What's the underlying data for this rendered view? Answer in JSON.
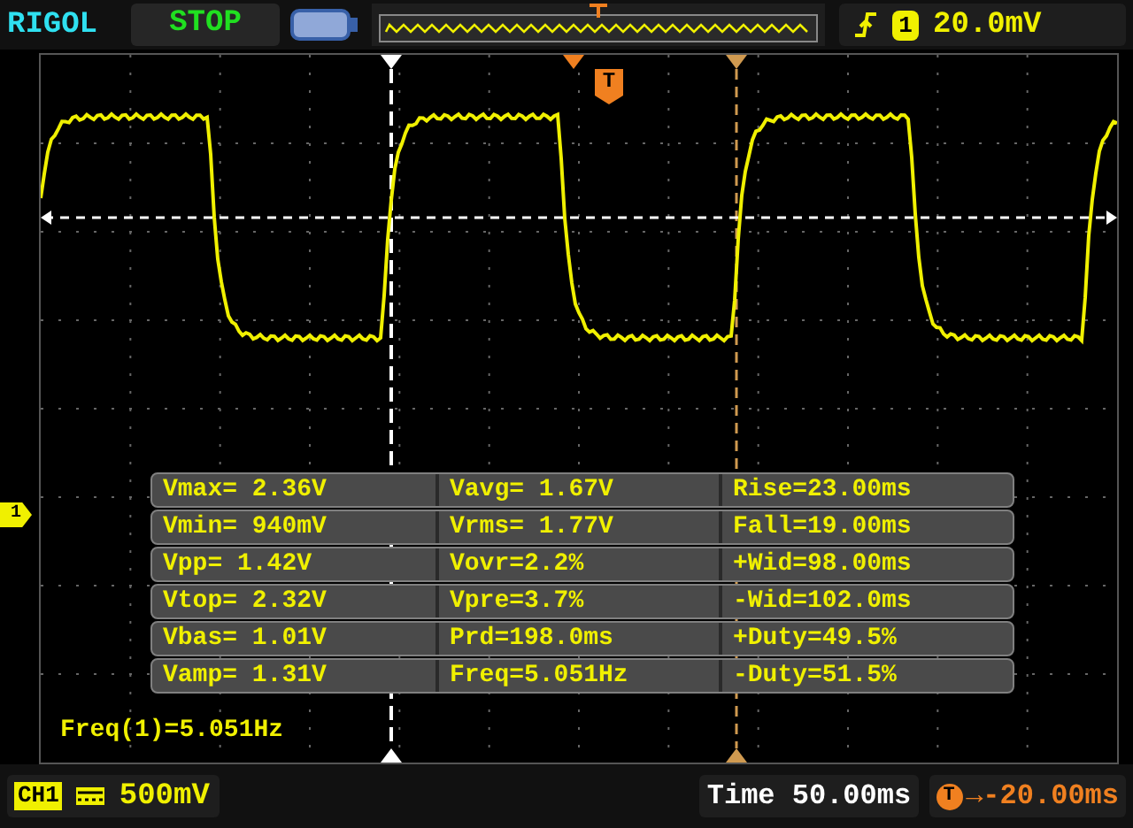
{
  "top_bar": {
    "brand": "RIGOL",
    "run_state": "STOP",
    "trigger": {
      "channel": "1",
      "level": "20.0mV"
    }
  },
  "channel_marker": "1",
  "trigger_marker": "T",
  "measurements": [
    {
      "cells": [
        "Vmax= 2.36V",
        "Vavg= 1.67V",
        "Rise=23.00ms"
      ]
    },
    {
      "cells": [
        "Vmin= 940mV",
        "Vrms= 1.77V",
        "Fall=19.00ms"
      ]
    },
    {
      "cells": [
        "Vpp= 1.42V",
        "Vovr=2.2%",
        "+Wid=98.00ms"
      ]
    },
    {
      "cells": [
        "Vtop= 2.32V",
        "Vpre=3.7%",
        "-Wid=102.0ms"
      ]
    },
    {
      "cells": [
        "Vbas= 1.01V",
        "Prd=198.0ms",
        "+Duty=49.5%"
      ]
    },
    {
      "cells": [
        "Vamp= 1.31V",
        "Freq=5.051Hz",
        "-Duty=51.5%"
      ]
    }
  ],
  "freq_readout": "Freq(1)=5.051Hz",
  "bottom_bar": {
    "channel": "CH1",
    "scale": "500mV",
    "timebase": "Time 50.00ms",
    "trigger_offset": {
      "marker": "T",
      "value": "→-20.00ms"
    }
  }
}
